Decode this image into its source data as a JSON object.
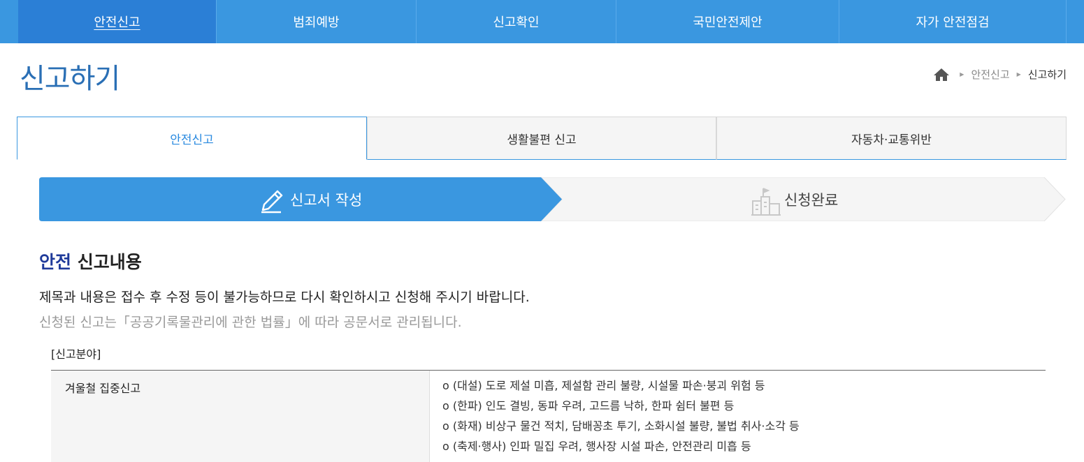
{
  "topnav": {
    "items": [
      {
        "label": "안전신고",
        "active": true
      },
      {
        "label": "범죄예방",
        "active": false
      },
      {
        "label": "신고확인",
        "active": false
      },
      {
        "label": "국민안전제안",
        "active": false
      },
      {
        "label": "자가 안전점검",
        "active": false
      }
    ]
  },
  "page": {
    "title": "신고하기"
  },
  "breadcrumb": {
    "home_icon": "home-icon",
    "items": [
      "안전신고",
      "신고하기"
    ]
  },
  "tabs": [
    {
      "label": "안전신고",
      "active": true
    },
    {
      "label": "생활불편 신고",
      "active": false
    },
    {
      "label": "자동차·교통위반",
      "active": false
    }
  ],
  "steps": [
    {
      "label": "신고서 작성",
      "icon": "pencil-icon",
      "active": true
    },
    {
      "label": "신청완료",
      "icon": "building-flag-icon",
      "active": false
    }
  ],
  "section": {
    "title_accent": "안전",
    "title_rest": " 신고내용",
    "notice_primary": "제목과 내용은 접수 후 수정 등이 불가능하므로 다시 확인하시고 신청해 주시기 바랍니다.",
    "notice_secondary": "신청된 신고는「공공기록물관리에 관한 법률」에 따라 공문서로 관리됩니다.",
    "field_label": "[신고분야]"
  },
  "category": {
    "name": "겨울철 집중신고",
    "lines": [
      "o (대설) 도로 제설 미흡, 제설함 관리 불량, 시설물 파손·붕괴 위험 등",
      "o (한파) 인도 결빙, 동파 우려, 고드름 낙하, 한파 쉼터 불편 등",
      "o (화재) 비상구 물건 적치, 담배꽁초 투기, 소화시설 불량, 불법 취사·소각 등",
      "o (축제·행사) 인파 밀집 우려, 행사장 시설 파손, 안전관리 미흡 등"
    ]
  },
  "colors": {
    "nav_bg": "#3a97e0",
    "nav_active": "#2b7fd6",
    "title_blue": "#2a6fb5",
    "accent_navy": "#1f3a9a"
  }
}
